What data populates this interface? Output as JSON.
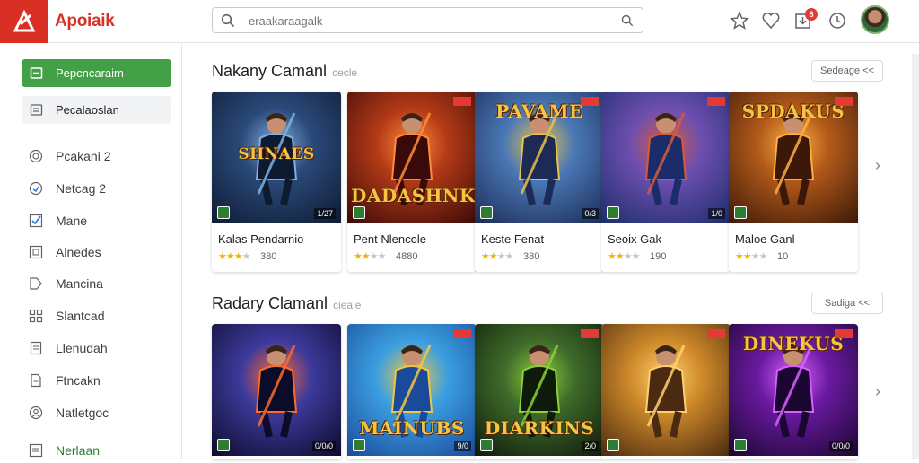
{
  "header": {
    "app_name": "Apoiaik",
    "search": {
      "value": "",
      "placeholder": "eraakaraagalk"
    },
    "notification_count": "8"
  },
  "sidebar": {
    "primary": "Pepcncaraim",
    "secondary": "Pecalaoslan",
    "items": [
      {
        "label": "Pcakani",
        "count": "2",
        "icon": "circle-target-icon"
      },
      {
        "label": "Netcag",
        "count": "2",
        "icon": "shield-icon"
      },
      {
        "label": "Mane",
        "count": "",
        "icon": "check-square-icon"
      },
      {
        "label": "Alnedes",
        "count": "",
        "icon": "square-icon"
      },
      {
        "label": "Mancina",
        "count": "",
        "icon": "tag-icon"
      },
      {
        "label": "Slantcad",
        "count": "",
        "icon": "grid-icon"
      },
      {
        "label": "Llenudah",
        "count": "",
        "icon": "document-icon"
      },
      {
        "label": "Ftncakn",
        "count": "",
        "icon": "file-icon"
      },
      {
        "label": "Natletgoc",
        "count": "",
        "icon": "user-circle-icon"
      },
      {
        "label": "Nerlaan",
        "count": "",
        "icon": "list-icon"
      }
    ]
  },
  "sections": [
    {
      "title": "Nakany Camanl",
      "subtitle": "cecle",
      "see_more": "Sedeage <<",
      "cards": [
        {
          "name": "Kalas Pendarnio",
          "stars": 3,
          "rating": "380",
          "art": "SHNAES",
          "bg1": "#2a4a7a",
          "bg2": "#0e1a30",
          "accent": "#7fb0e0",
          "dl": "1/27"
        },
        {
          "name": "Pent Nlencole",
          "stars": 2,
          "rating": "4880",
          "art": "DADASHNK",
          "bg1": "#b33a16",
          "bg2": "#3a0a08",
          "accent": "#ff8a3a",
          "dl": ""
        },
        {
          "name": "Keste Fenat",
          "stars": 2,
          "rating": "380",
          "art": "PAVAME",
          "bg1": "#4a78b5",
          "bg2": "#1c2a55",
          "accent": "#e9c04a",
          "dl": "0/3"
        },
        {
          "name": "Seoix Gak",
          "stars": 2,
          "rating": "190",
          "art": "",
          "bg1": "#6d4fb0",
          "bg2": "#1a2d6a",
          "accent": "#d85a3a",
          "dl": "1/0"
        },
        {
          "name": "Maloe Ganl",
          "stars": 2,
          "rating": "10",
          "art": "SPDAKUS",
          "bg1": "#b35a1a",
          "bg2": "#3b1808",
          "accent": "#ffb040",
          "dl": ""
        }
      ]
    },
    {
      "title": "Radary Clamanl",
      "subtitle": "cieale",
      "see_more": "Sadiga <<",
      "cards": [
        {
          "name": "",
          "stars": 0,
          "rating": "",
          "art": "",
          "bg1": "#3d3a9c",
          "bg2": "#0d0b2a",
          "accent": "#ff6a2a",
          "dl": "0/0/0"
        },
        {
          "name": "",
          "stars": 0,
          "rating": "",
          "art": "MAINUBS",
          "bg1": "#3b9fe0",
          "bg2": "#1a4a9a",
          "accent": "#f4c542",
          "dl": "9/0"
        },
        {
          "name": "",
          "stars": 0,
          "rating": "",
          "art": "DIARKINS",
          "bg1": "#3f6b2a",
          "bg2": "#0e1a0a",
          "accent": "#8ccf3a",
          "dl": "2/0"
        },
        {
          "name": "",
          "stars": 0,
          "rating": "",
          "art": "",
          "bg1": "#d08b2a",
          "bg2": "#4a2a10",
          "accent": "#ffd070",
          "dl": ""
        },
        {
          "name": "",
          "stars": 0,
          "rating": "",
          "art": "DINEKUS",
          "bg1": "#6a1aa0",
          "bg2": "#1a0630",
          "accent": "#d860ff",
          "dl": "0/0/0"
        }
      ]
    }
  ],
  "colors": {
    "brand": "#d93025",
    "primary_nav": "#43a047",
    "star": "#f4b400"
  }
}
